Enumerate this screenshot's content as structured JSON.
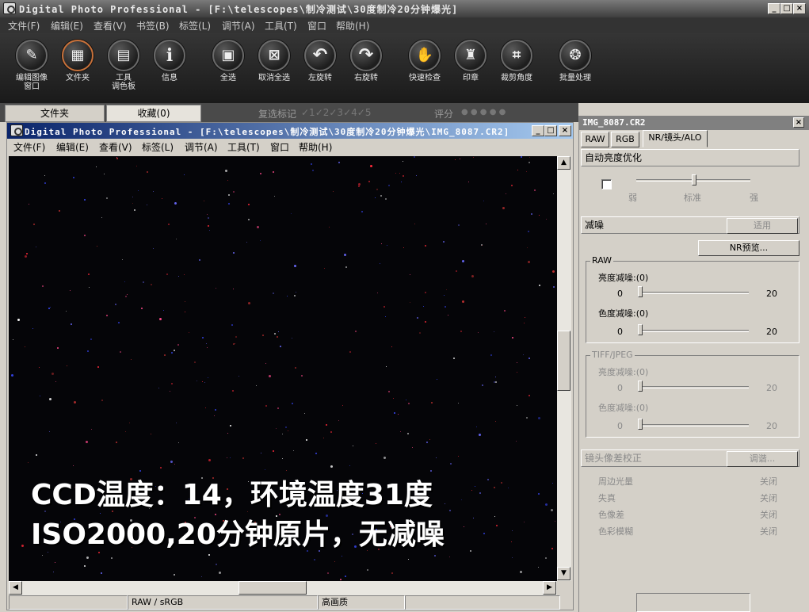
{
  "window": {
    "title": "Digital Photo Professional - [F:\\telescopes\\制冷测试\\30度制冷20分钟爆光]",
    "min_label": "_",
    "max_label": "□",
    "close_label": "×"
  },
  "menubar": [
    "文件(F)",
    "编辑(E)",
    "查看(V)",
    "书签(B)",
    "标签(L)",
    "调节(A)",
    "工具(T)",
    "窗口",
    "帮助(H)"
  ],
  "toolbar": [
    {
      "label": "编辑图像\n窗口",
      "icon": "edit-image-icon",
      "glyph": "✎"
    },
    {
      "label": "文件夹",
      "icon": "folder-icon",
      "glyph": "▦"
    },
    {
      "label": "工具\n调色板",
      "icon": "tool-palette-icon",
      "glyph": "▤"
    },
    {
      "label": "信息",
      "icon": "info-icon",
      "glyph": "i"
    },
    {
      "label": "全选",
      "icon": "select-all-icon",
      "glyph": "▣"
    },
    {
      "label": "取消全选",
      "icon": "deselect-all-icon",
      "glyph": "⊠"
    },
    {
      "label": "左旋转",
      "icon": "rotate-left-icon",
      "glyph": "↶"
    },
    {
      "label": "右旋转",
      "icon": "rotate-right-icon",
      "glyph": "↷"
    },
    {
      "label": "快速检查",
      "icon": "quick-check-icon",
      "glyph": "✋"
    },
    {
      "label": "印章",
      "icon": "stamp-icon",
      "glyph": "♜"
    },
    {
      "label": "裁剪角度",
      "icon": "crop-angle-icon",
      "glyph": "⌗"
    },
    {
      "label": "批量处理",
      "icon": "batch-process-icon",
      "glyph": "❂"
    }
  ],
  "tabs": {
    "folder": "文件夹",
    "favorites": "收藏(0)",
    "check_mark_label": "复选标记",
    "check_marks": "✓1✓2✓3✓4✓5",
    "rating_label": "评分",
    "rating_dots": "● ● ● ● ●"
  },
  "editor": {
    "title": "Digital Photo Professional - [F:\\telescopes\\制冷测试\\30度制冷20分钟爆光\\IMG_8087.CR2]",
    "menubar": [
      "文件(F)",
      "编辑(E)",
      "查看(V)",
      "标签(L)",
      "调节(A)",
      "工具(T)",
      "窗口",
      "帮助(H)"
    ],
    "caption_line1": "CCD温度：14，环境温度31度",
    "caption_line2": "ISO2000,20分钟原片，无减噪",
    "status": {
      "colorspace": "RAW / sRGB",
      "quality": "高画质"
    }
  },
  "panel": {
    "title": "IMG_8087.CR2",
    "tabs": [
      "RAW",
      "RGB",
      "NR/镜头/ALO"
    ],
    "alo": {
      "header": "自动亮度优化",
      "low": "弱",
      "std": "标准",
      "high": "强"
    },
    "nr": {
      "header": "减噪",
      "apply": "适用",
      "preview": "NR预览...",
      "raw_group": "RAW",
      "raw_lum_label": "亮度减噪:(0)",
      "raw_chroma_label": "色度减噪:(0)",
      "min": "0",
      "max": "20",
      "tiff_group": "TIFF/JPEG",
      "tiff_lum_label": "亮度减噪:(0)",
      "tiff_chroma_label": "色度减噪:(0)"
    },
    "lens": {
      "header": "镜头像差校正",
      "adjust": "调谐...",
      "items": [
        {
          "label": "周边光量",
          "value": "关闭"
        },
        {
          "label": "失真",
          "value": "关闭"
        },
        {
          "label": "色像差",
          "value": "关闭"
        },
        {
          "label": "色彩模糊",
          "value": "关闭"
        }
      ]
    }
  },
  "colors": {
    "accent": "#c8713a",
    "title_blue": "#0a246a"
  }
}
